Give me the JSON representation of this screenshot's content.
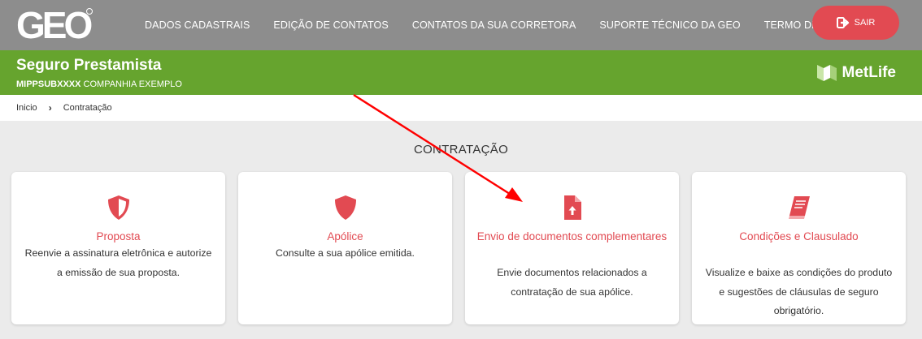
{
  "header": {
    "logo_text": "GEO",
    "nav": [
      {
        "label": "DADOS CADASTRAIS"
      },
      {
        "label": "EDIÇÃO DE CONTATOS"
      },
      {
        "label": "CONTATOS DA SUA CORRETORA"
      },
      {
        "label": "SUPORTE TÉCNICO DA GEO"
      },
      {
        "label": "TERMO DE USO"
      }
    ],
    "logout_label": "SAIR"
  },
  "product": {
    "title": "Seguro Prestamista",
    "code": "MIPPSUBXXXX",
    "company": "COMPANHIA EXEMPLO",
    "brand": "MetLife"
  },
  "breadcrumb": {
    "home": "Inicio",
    "current": "Contratação"
  },
  "section_title": "CONTRATAÇÃO",
  "cards": [
    {
      "icon": "shield-half-icon",
      "title": "Proposta",
      "description": "Reenvie a assinatura eletrônica e autorize a emissão de sua proposta."
    },
    {
      "icon": "shield-icon",
      "title": "Apólice",
      "description": "Consulte a sua apólice emitida."
    },
    {
      "icon": "file-upload-icon",
      "title": "Envio de documentos complementares",
      "description": "Envie documentos relacionados a contratação de sua apólice."
    },
    {
      "icon": "book-icon",
      "title": "Condições e Clausulado",
      "description": "Visualize e baixe as condições do produto e sugestões de cláusulas de seguro obrigatório."
    }
  ],
  "colors": {
    "topbar": "#8d8d8d",
    "product_bar": "#66a42e",
    "accent": "#e24a52",
    "annotation_arrow": "#ff0000"
  }
}
